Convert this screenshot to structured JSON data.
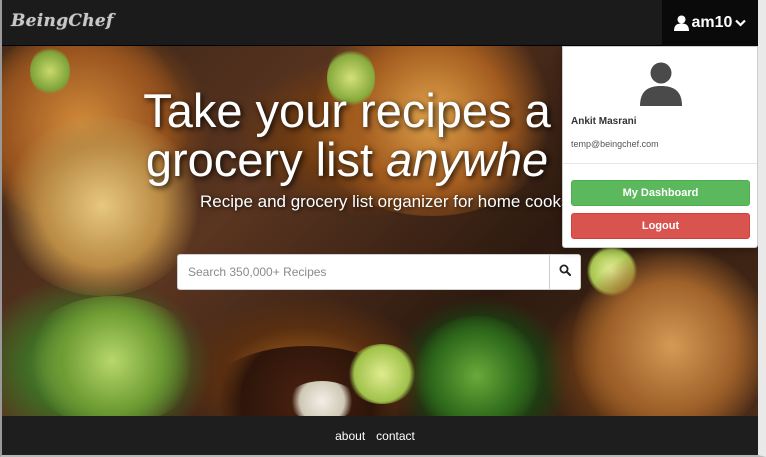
{
  "navbar": {
    "brand": "BeingChef",
    "user_label": "am10",
    "colors": {
      "bg": "#1b1b1b",
      "toggle_bg": "#0a0a0a"
    }
  },
  "hero": {
    "title_line1": "Take your recipes a",
    "title_line2_plain": "grocery list ",
    "title_line2_italic": "anywhe",
    "subtitle": "Recipe and grocery list organizer for home cooks.",
    "search_placeholder": "Search 350,000+ Recipes"
  },
  "dropdown": {
    "name": "Ankit Masrani",
    "email": "temp@beingchef.com",
    "dashboard_label": "My Dashboard",
    "logout_label": "Logout",
    "colors": {
      "dashboard": "#5cb85c",
      "logout": "#d9534f"
    }
  },
  "footer": {
    "links": [
      "about",
      "contact"
    ]
  },
  "icons": {
    "user": "user-icon",
    "caret": "chevron-down-icon",
    "search": "search-icon",
    "avatar": "avatar-silhouette-icon"
  }
}
